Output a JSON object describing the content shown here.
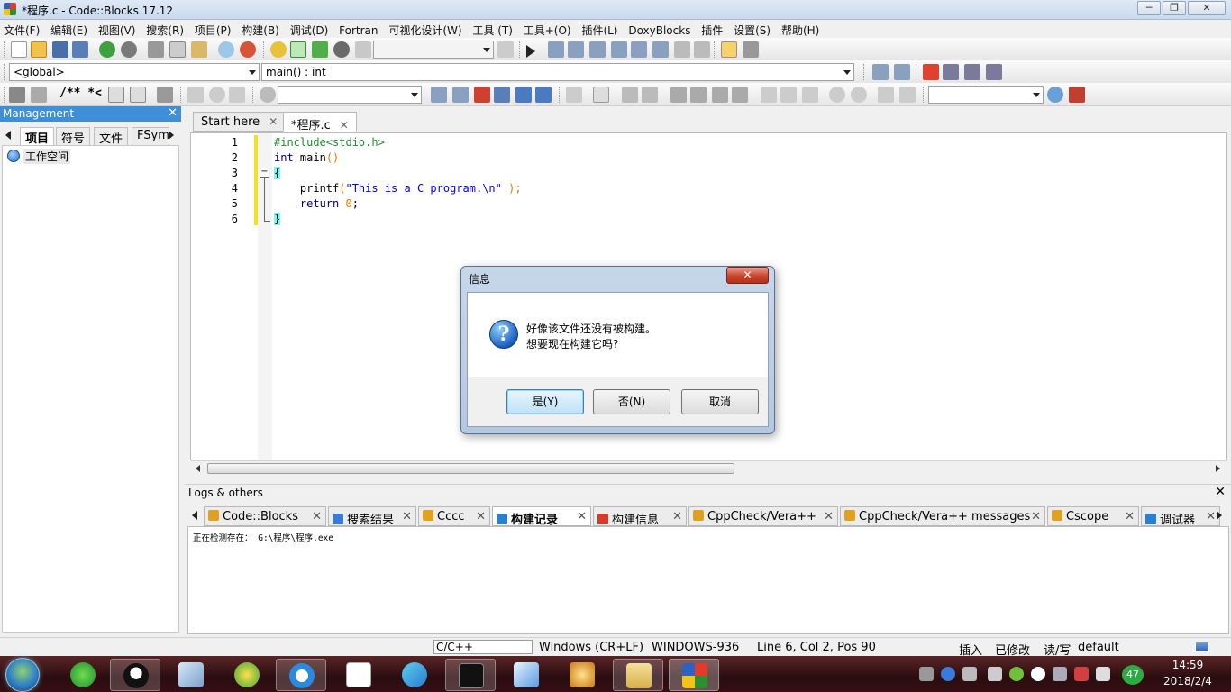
{
  "window": {
    "title": "*程序.c - Code::Blocks 17.12",
    "minimize": "─",
    "maximize": "❐",
    "close": "✕"
  },
  "menu": [
    "文件(F)",
    "编辑(E)",
    "视图(V)",
    "搜索(R)",
    "项目(P)",
    "构建(B)",
    "调试(D)",
    "Fortran",
    "可视化设计(W)",
    "工具 (T)",
    "工具+(O)",
    "插件(L)",
    "DoxyBlocks",
    "插件",
    "设置(S)",
    "帮助(H)"
  ],
  "toolbar3": {
    "doxy_label": "/** *<"
  },
  "codecompletion": {
    "scope": "<global>",
    "function": "main() : int"
  },
  "management": {
    "title": "Management",
    "close": "✕",
    "tabs": [
      "项目",
      "符号",
      "文件",
      "FSym"
    ],
    "workspace": "工作空间"
  },
  "editor": {
    "tabs": [
      {
        "label": "Start here",
        "close": "✕"
      },
      {
        "label": "*程序.c",
        "close": "✕"
      }
    ],
    "lines": [
      {
        "n": "1",
        "parts": [
          {
            "c": "pp",
            "t": "#include<stdio.h>"
          }
        ]
      },
      {
        "n": "2",
        "parts": [
          {
            "c": "kw",
            "t": "int"
          },
          {
            "c": "br",
            "t": " main"
          },
          {
            "c": "num",
            "t": "()"
          }
        ]
      },
      {
        "n": "3",
        "parts": [
          {
            "c": "brace-hl",
            "t": "{"
          }
        ]
      },
      {
        "n": "4",
        "parts": [
          {
            "c": "br",
            "t": "    printf"
          },
          {
            "c": "num",
            "t": "("
          },
          {
            "c": "str",
            "t": "\"This is a C program.\\n\""
          },
          {
            "c": "br",
            "t": " "
          },
          {
            "c": "num",
            "t": ");"
          }
        ]
      },
      {
        "n": "5",
        "parts": [
          {
            "c": "kw",
            "t": "    return"
          },
          {
            "c": "br",
            "t": " "
          },
          {
            "c": "num",
            "t": "0"
          },
          {
            "c": "br",
            "t": ";"
          }
        ]
      },
      {
        "n": "6",
        "parts": [
          {
            "c": "brace-hl",
            "t": "}"
          }
        ]
      }
    ],
    "fold_marker": "−"
  },
  "logs": {
    "title": "Logs & others",
    "close": "✕",
    "tabs": [
      {
        "label": "Code::Blocks",
        "icon": "pencil-icon",
        "color": "#e0a020"
      },
      {
        "label": "搜索结果",
        "icon": "search-icon",
        "color": "#3a7bd5"
      },
      {
        "label": "Cccc",
        "icon": "pencil-icon",
        "color": "#e0a020"
      },
      {
        "label": "构建记录",
        "icon": "gear-icon",
        "color": "#2a7fd0",
        "active": true
      },
      {
        "label": "构建信息",
        "icon": "pin-icon",
        "color": "#d83a2a"
      },
      {
        "label": "CppCheck/Vera++",
        "icon": "pencil-icon",
        "color": "#e0a020"
      },
      {
        "label": "CppCheck/Vera++ messages",
        "icon": "pencil-icon",
        "color": "#e0a020"
      },
      {
        "label": "Cscope",
        "icon": "pencil-icon",
        "color": "#e0a020"
      },
      {
        "label": "调试器",
        "icon": "gear-icon",
        "color": "#2a7fd0"
      }
    ],
    "tab_close": "✕",
    "line": "正在检测存在： G:\\程序\\程序.exe"
  },
  "status": {
    "lang": "C/C++",
    "eol": "Windows (CR+LF)",
    "encoding": "WINDOWS-936",
    "position": "Line 6, Col 2, Pos 90",
    "insert": "插入",
    "modified": "已修改",
    "rw": "读/写",
    "profile": "default"
  },
  "dialog": {
    "title": "信息",
    "close": "✕",
    "icon": "?",
    "message_line1": "好像该文件还没有被构建。",
    "message_line2": "想要现在构建它吗?",
    "yes": "是(Y)",
    "no": "否(N)",
    "cancel": "取消"
  },
  "taskbar": {
    "time": "14:59",
    "date": "2018/2/4",
    "badge": "47"
  }
}
